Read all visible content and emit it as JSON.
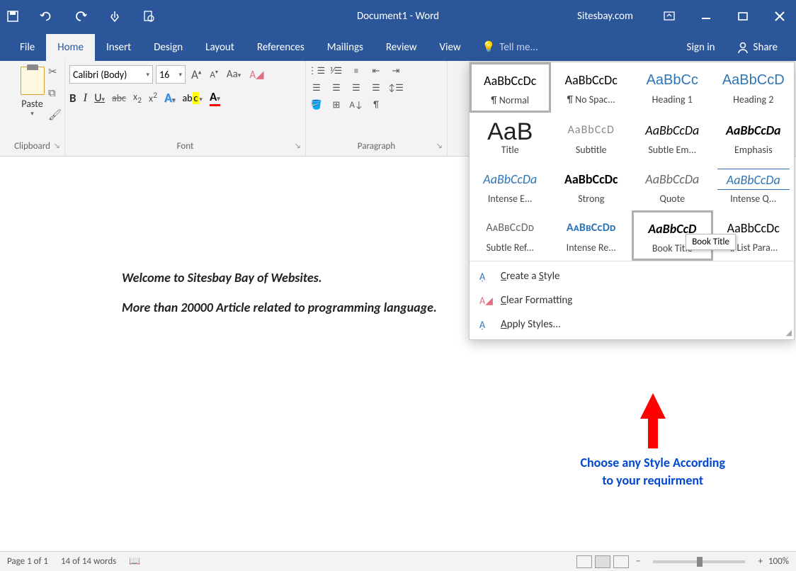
{
  "titlebar": {
    "doc_title": "Document1 - Word",
    "site": "Sitesbay.com"
  },
  "tabs": {
    "file": "File",
    "home": "Home",
    "insert": "Insert",
    "design": "Design",
    "layout": "Layout",
    "references": "References",
    "mailings": "Mailings",
    "review": "Review",
    "view": "View",
    "tellme": "Tell me...",
    "signin": "Sign in",
    "share": "Share"
  },
  "ribbon": {
    "clipboard": {
      "paste": "Paste",
      "label": "Clipboard"
    },
    "font": {
      "name": "Calibri (Body)",
      "size": "16",
      "label": "Font"
    },
    "paragraph": {
      "label": "Paragraph"
    }
  },
  "styles": {
    "grid": [
      {
        "preview": "AaBbCcDc",
        "label": "¶ Normal",
        "cls": "",
        "sel": true
      },
      {
        "preview": "AaBbCcDc",
        "label": "¶ No Spac...",
        "cls": ""
      },
      {
        "preview": "AaBbCc",
        "label": "Heading 1",
        "cls": "heading"
      },
      {
        "preview": "AaBbCcD",
        "label": "Heading 2",
        "cls": "heading"
      },
      {
        "preview": "AaB",
        "label": "Title",
        "cls": "title"
      },
      {
        "preview": "AaBbCcD",
        "label": "Subtitle",
        "cls": "subtitle"
      },
      {
        "preview": "AaBbCcDa",
        "label": "Subtle Em...",
        "cls": "emphasis"
      },
      {
        "preview": "AaBbCcDa",
        "label": "Emphasis",
        "cls": "emphasis strong"
      },
      {
        "preview": "AaBbCcDa",
        "label": "Intense E...",
        "cls": "intense-e"
      },
      {
        "preview": "AaBbCcDc",
        "label": "Strong",
        "cls": "strong"
      },
      {
        "preview": "AaBbCcDa",
        "label": "Quote",
        "cls": "quote"
      },
      {
        "preview": "AaBbCcDa",
        "label": "Intense Q...",
        "cls": "intense-q"
      },
      {
        "preview": "AᴀBʙCᴄDᴅ",
        "label": "Subtle Ref...",
        "cls": "subtle-ref"
      },
      {
        "preview": "AᴀBʙCᴄDᴅ",
        "label": "Intense Re...",
        "cls": "intense-ref"
      },
      {
        "preview": "AaBbCcD",
        "label": "Book Title",
        "cls": "booktitle",
        "sel": true
      },
      {
        "preview": "AaBbCcDc",
        "label": "¶ List Para...",
        "cls": ""
      }
    ],
    "menu": {
      "create": "Create a Style",
      "clear": "Clear Formatting",
      "apply": "Apply Styles..."
    },
    "tooltip": "Book Title"
  },
  "document": {
    "line1": "Welcome to Sitesbay Bay of Websites.",
    "line2": "More than 20000 Article related to programming language."
  },
  "annotation": {
    "line1": "Choose any Style According",
    "line2": "to your requirment"
  },
  "statusbar": {
    "page": "Page 1 of 1",
    "words": "14 of 14 words",
    "zoom": "100%"
  }
}
